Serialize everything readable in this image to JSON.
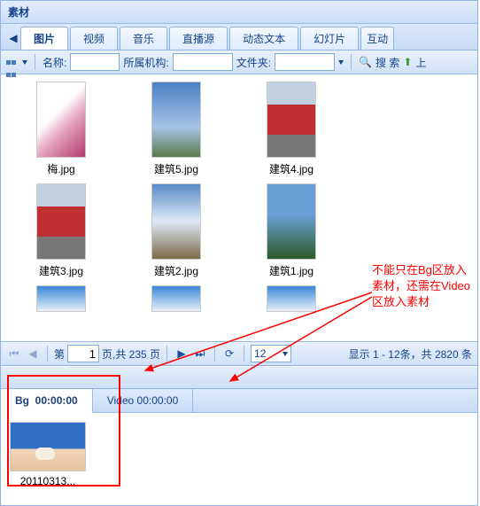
{
  "panel_title": "素材",
  "tabs": [
    "图片",
    "视频",
    "音乐",
    "直播源",
    "动态文本",
    "幻灯片",
    "互动"
  ],
  "active_tab": 0,
  "toolbar": {
    "name_label": "名称:",
    "org_label": "所属机构:",
    "folder_label": "文件夹:",
    "search_label": "搜 索",
    "upload_label": "上"
  },
  "thumbnails": [
    [
      {
        "label": "梅.jpg",
        "cls": "bg-plum"
      },
      {
        "label": "建筑5.jpg",
        "cls": "bg-tower"
      },
      {
        "label": "建筑4.jpg",
        "cls": "bg-bus"
      }
    ],
    [
      {
        "label": "建筑3.jpg",
        "cls": "bg-bus"
      },
      {
        "label": "建筑2.jpg",
        "cls": "bg-build"
      },
      {
        "label": "建筑1.jpg",
        "cls": "bg-mtn"
      }
    ],
    [
      {
        "label": "",
        "cls": "bg-sky",
        "half": true
      },
      {
        "label": "",
        "cls": "bg-sky",
        "half": true
      },
      {
        "label": "",
        "cls": "bg-sky",
        "half": true
      }
    ]
  ],
  "paging": {
    "page_label_prefix": "第",
    "page_value": "1",
    "page_label_suffix": "页,共 235 页",
    "page_size": "12",
    "status": "显示 1 - 12条，共 2820 条"
  },
  "lower_tabs": {
    "bg": {
      "name": "Bg",
      "time": "00:00:00"
    },
    "video": {
      "name": "Video",
      "time": "00:00:00"
    }
  },
  "clip": {
    "label": "20110313..."
  },
  "annotation_text_l1": "不能只在Bg区放入",
  "annotation_text_l2": "素材，还需在Video",
  "annotation_text_l3": "区放入素材"
}
